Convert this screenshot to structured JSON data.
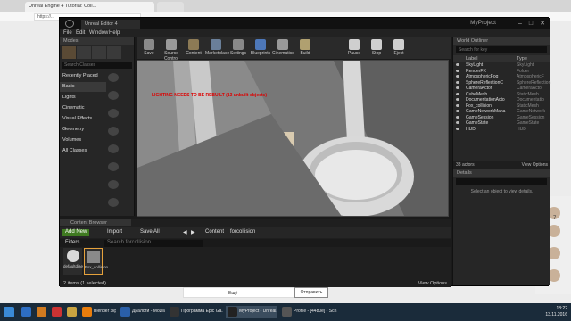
{
  "browser": {
    "tabs": [
      {
        "label": "Unreal Engine 4 Tutorial: Coll..."
      },
      {
        "label": ""
      }
    ],
    "url": "https://...",
    "right_numbers": [
      "7"
    ]
  },
  "ue": {
    "tab_title": "Unreal Editor 4",
    "project_name": "MyProject",
    "menu": [
      "File",
      "Edit",
      "Window",
      "Help"
    ],
    "modes": {
      "header": "Modes",
      "search_placeholder": "Search Classes",
      "categories": [
        "Recently Placed",
        "Basic",
        "Lights",
        "Cinematic",
        "Visual Effects",
        "Geometry",
        "Volumes",
        "All Classes"
      ]
    },
    "toolbar": [
      {
        "label": "Save",
        "icon": "save-icon",
        "color": "#8a8a8a"
      },
      {
        "label": "Source Control",
        "icon": "source-control-icon",
        "color": "#9a9a9a"
      },
      {
        "label": "Content",
        "icon": "content-icon",
        "color": "#8c7a55"
      },
      {
        "label": "Marketplace",
        "icon": "marketplace-icon",
        "color": "#6a7f99"
      },
      {
        "label": "Settings",
        "icon": "settings-icon",
        "color": "#888"
      },
      {
        "label": "Blueprints",
        "icon": "blueprints-icon",
        "color": "#4d77b8"
      },
      {
        "label": "Cinematics",
        "icon": "cinematics-icon",
        "color": "#999"
      },
      {
        "label": "Build",
        "icon": "build-icon",
        "color": "#b0a070"
      },
      {
        "label": "Pause",
        "icon": "pause-icon",
        "color": "#cfcfcf"
      },
      {
        "label": "Stop",
        "icon": "stop-icon",
        "color": "#cfcfcf"
      },
      {
        "label": "Eject",
        "icon": "eject-icon",
        "color": "#cfcfcf"
      }
    ],
    "viewport": {
      "warning": "LIGHTING NEEDS TO BE REBUILT (13 unbuilt objects)"
    },
    "outliner": {
      "header": "World Outliner",
      "search_placeholder": "Search for key",
      "col_label": "Label",
      "col_type": "Type",
      "rows": [
        {
          "label": "SkyLight",
          "type": "SkyLight"
        },
        {
          "label": "RenderFX",
          "type": "Folder"
        },
        {
          "label": "AtmosphericFog",
          "type": "AtmosphericF"
        },
        {
          "label": "SphereReflectionC",
          "type": "SphereReflection"
        },
        {
          "label": "CameraActor",
          "type": "CameraActo"
        },
        {
          "label": "CubeMesh",
          "type": "StaticMesh"
        },
        {
          "label": "DocumentationActo",
          "type": "Documentatio"
        },
        {
          "label": "Fox_collision",
          "type": "StaticMesh"
        },
        {
          "label": "GameNetworkMana",
          "type": "GameNetwork"
        },
        {
          "label": "GameSession",
          "type": "GameSession"
        },
        {
          "label": "GameState",
          "type": "GameState"
        },
        {
          "label": "HUD",
          "type": "HUD"
        }
      ],
      "actor_count": "38 actors",
      "view_options": "View Options"
    },
    "details": {
      "header": "Details",
      "hint": "Select an object to view details."
    },
    "content_browser": {
      "tab": "Content Browser",
      "add_new": "Add New",
      "import": "Import",
      "save_all": "Save All",
      "path": [
        "Content",
        "forcollision"
      ],
      "filters": "Filters",
      "search_placeholder": "Search forcollision",
      "assets": [
        {
          "name": "defaultdiae",
          "selected": false
        },
        {
          "name": "Fox_collision",
          "selected": true
        }
      ],
      "status": "2 items (1 selected)",
      "view_options": "View Options"
    }
  },
  "page": {
    "chat_placeholder": "Ещё",
    "send_label": "Отправить"
  },
  "taskbar": {
    "items": [
      {
        "label": "",
        "color": "#2d6ec4"
      },
      {
        "label": "",
        "color": "#d07a20"
      },
      {
        "label": "",
        "color": "#c33"
      },
      {
        "label": "",
        "color": "#c9a441"
      },
      {
        "label": "Blender экранск",
        "color": "#e87d0d"
      },
      {
        "label": "Диалоги - Mozilla Fir...",
        "color": "#2a5fa8"
      },
      {
        "label": "Программа Epic Ga...",
        "color": "#333"
      },
      {
        "label": "MyProject - Unreal...",
        "color": "#222"
      },
      {
        "label": "Profile - [4480e] - Sce...",
        "color": "#555"
      }
    ],
    "time": "18:22",
    "date": "13.11.2016"
  }
}
